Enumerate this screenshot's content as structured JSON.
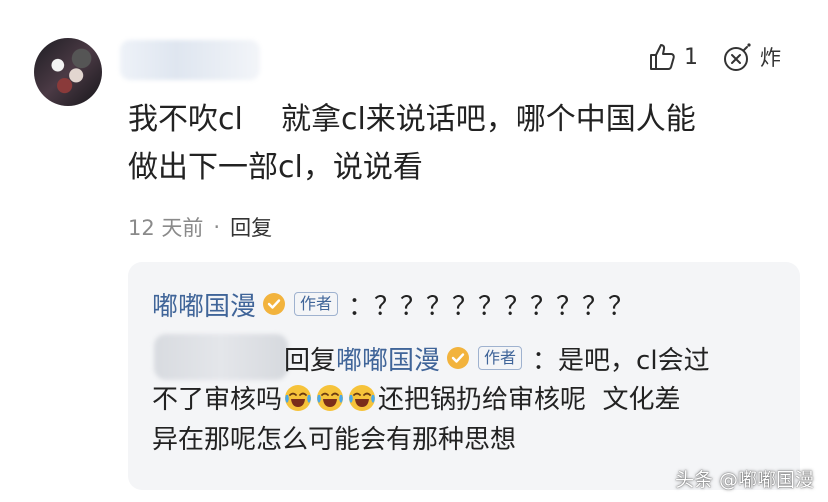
{
  "comment": {
    "avatar_icon": "anime-avatar",
    "like_count": "1",
    "bomb_label": "炸",
    "text_lines": [
      "我不吹cl    就拿cl来说话吧，哪个中国人能",
      "做出下一部cl，说说看"
    ],
    "time": "12 天前",
    "separator": "·",
    "reply_label": "回复"
  },
  "replies": [
    {
      "author": "嘟嘟国漫",
      "author_tag": "作者",
      "content": "：？？？？？？？？？？"
    },
    {
      "reply_word": "回复",
      "reply_to": "嘟嘟国漫",
      "author_tag": "作者",
      "content_start": "：是吧，cl会过",
      "line2_before": "不了审核吗",
      "line2_after": "还把锅扔给审核呢  文化差",
      "line3": "异在那呢怎么可能会有那种思想",
      "emoji_name": "laughing-crying-emoji"
    }
  ],
  "watermark": "头条 @嘟嘟国漫",
  "colors": {
    "link": "#406599",
    "badge": "#f2b33d",
    "reply_bg": "#f4f5f7"
  }
}
